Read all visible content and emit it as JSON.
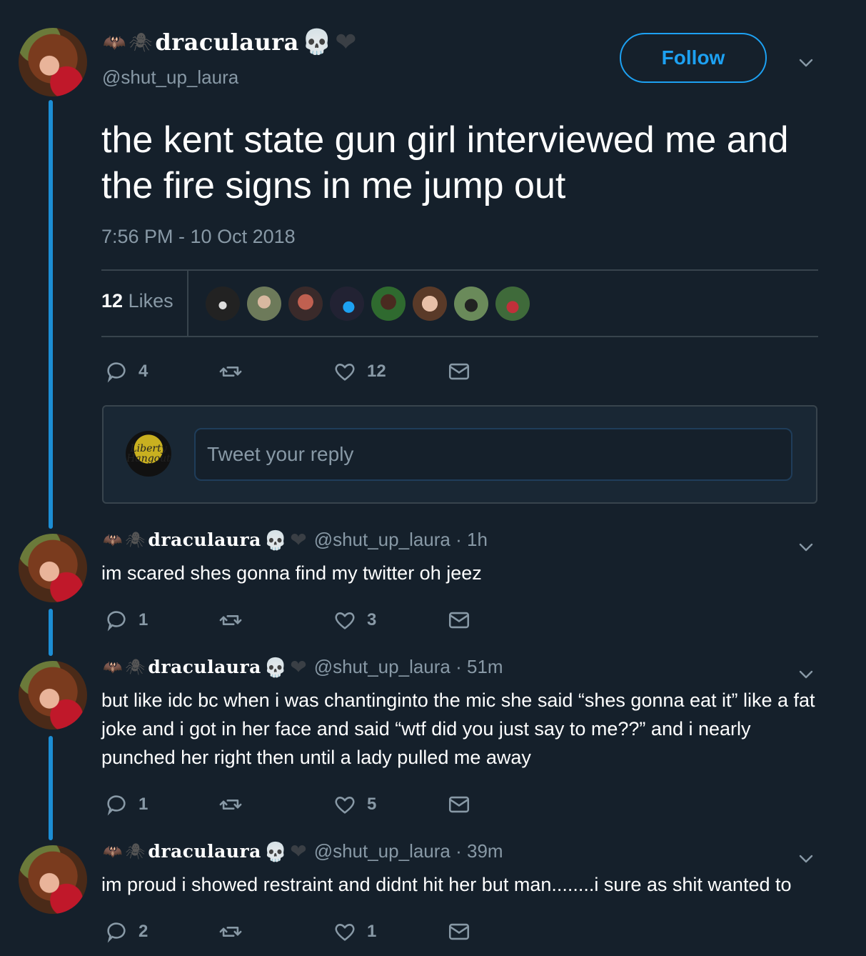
{
  "main_tweet": {
    "display_name": "draculaura",
    "handle": "@shut_up_laura",
    "follow_label": "Follow",
    "text": "the kent state gun girl interviewed me and the fire signs in me jump out",
    "timestamp": "7:56 PM - 10 Oct 2018",
    "likes_count": "12",
    "likes_word": "Likes",
    "reply_count": "4",
    "like_count_action": "12"
  },
  "reply_box": {
    "placeholder": "Tweet your reply",
    "avatar_text": "Liberty Hangout"
  },
  "replies": [
    {
      "display_name": "draculaura",
      "meta": "@shut_up_laura · 1h",
      "text": "im scared shes gonna find my twitter oh jeez",
      "reply_count": "1",
      "like_count": "3"
    },
    {
      "display_name": "draculaura",
      "meta": "@shut_up_laura · 51m",
      "text": "but like idc bc when i was chantinginto the mic she said “shes gonna eat it” like a fat joke and i got in her face and said “wtf did you just say to me??” and i nearly punched her right then until a lady pulled me away",
      "reply_count": "1",
      "like_count": "5"
    },
    {
      "display_name": "draculaura",
      "meta": "@shut_up_laura · 39m",
      "text": "im proud i showed restraint and didnt hit her but man........i sure as shit wanted to",
      "reply_count": "2",
      "like_count": "1"
    }
  ],
  "colors": {
    "background": "#15202b",
    "accent": "#1da1f2",
    "muted": "#8899a6",
    "divider": "#38444d"
  },
  "icons": [
    "bat-icon",
    "spider-icon",
    "skull-icon",
    "black-heart-icon",
    "reply-icon",
    "retweet-icon",
    "like-icon",
    "dm-icon",
    "chevron-down-icon"
  ]
}
